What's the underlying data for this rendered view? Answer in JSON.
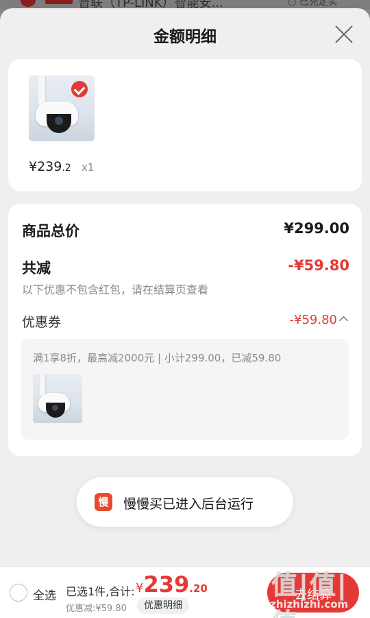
{
  "underlay": {
    "text": "普联（TP-LINK）智能安...",
    "right_text": "○ 已充定实"
  },
  "sheet": {
    "title": "金额明细"
  },
  "product": {
    "price_int": "¥239",
    "price_dec": ".2",
    "qty": "x1"
  },
  "summary": {
    "total_label": "商品总价",
    "total_value": "¥299.00",
    "reduce_label": "共减",
    "reduce_value": "-¥59.80",
    "hint": "以下优惠不包含红包，请在结算页查看",
    "coupon_label": "优惠券",
    "coupon_value": "-¥59.80",
    "coupon_desc": "满1享8折，最高减2000元 | 小计299.00，已减59.80"
  },
  "toast": {
    "logo": "慢",
    "text": "慢慢买已进入后台运行"
  },
  "bottom": {
    "select_all": "全选",
    "selected_info": "已选1件,合计:",
    "total_sym": "¥",
    "total_int": "239",
    "total_dec": ".20",
    "discount": "优惠减:¥59.80",
    "detail_button": "优惠明细",
    "checkout_button": "去结算"
  },
  "watermark": {
    "big": "值|值|值",
    "small": "zhizhizhi.com"
  },
  "colors": {
    "accent_red": "#e53935",
    "text_gray": "#8a8a8a"
  }
}
